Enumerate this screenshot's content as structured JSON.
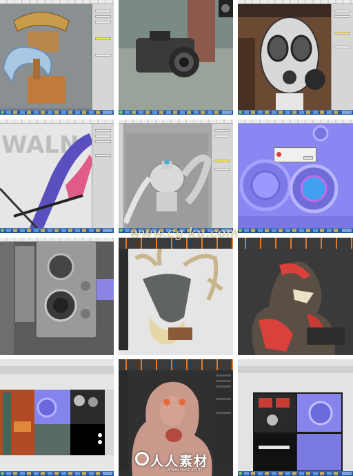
{
  "watermark": {
    "text": "www.cg-ku.com"
  },
  "logo": {
    "text": "人人素材",
    "url": "www.rr-sc.com"
  },
  "tiles": [
    "max-carousel-render",
    "max-camera-model",
    "max-gasmask-model",
    "max-bow-uv",
    "max-vase-wireframe",
    "max-normal-map-bake",
    "twin-lens-camera-render",
    "deer-skull-zbrush",
    "demon-bust-zbrush",
    "texture-atlas-photoshop",
    "creature-sculpt-zbrush",
    "normal-map-atlas"
  ]
}
